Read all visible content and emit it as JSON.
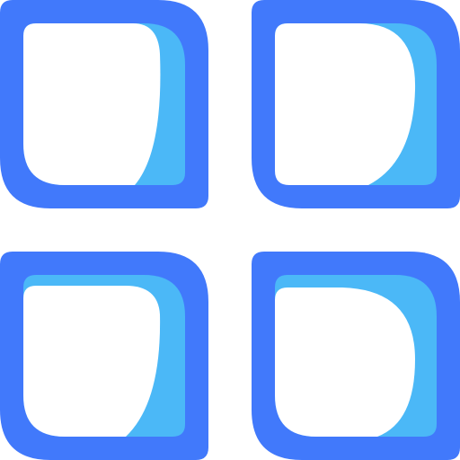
{
  "icon": {
    "name": "grid-menu-icon",
    "tile_names": [
      "tile-top-left-icon",
      "tile-top-right-icon",
      "tile-bottom-left-icon",
      "tile-bottom-right-icon"
    ]
  },
  "colors": {
    "outer": "#4179fb",
    "inner_accent": "#4bb8f7",
    "background": "#ffffff"
  }
}
